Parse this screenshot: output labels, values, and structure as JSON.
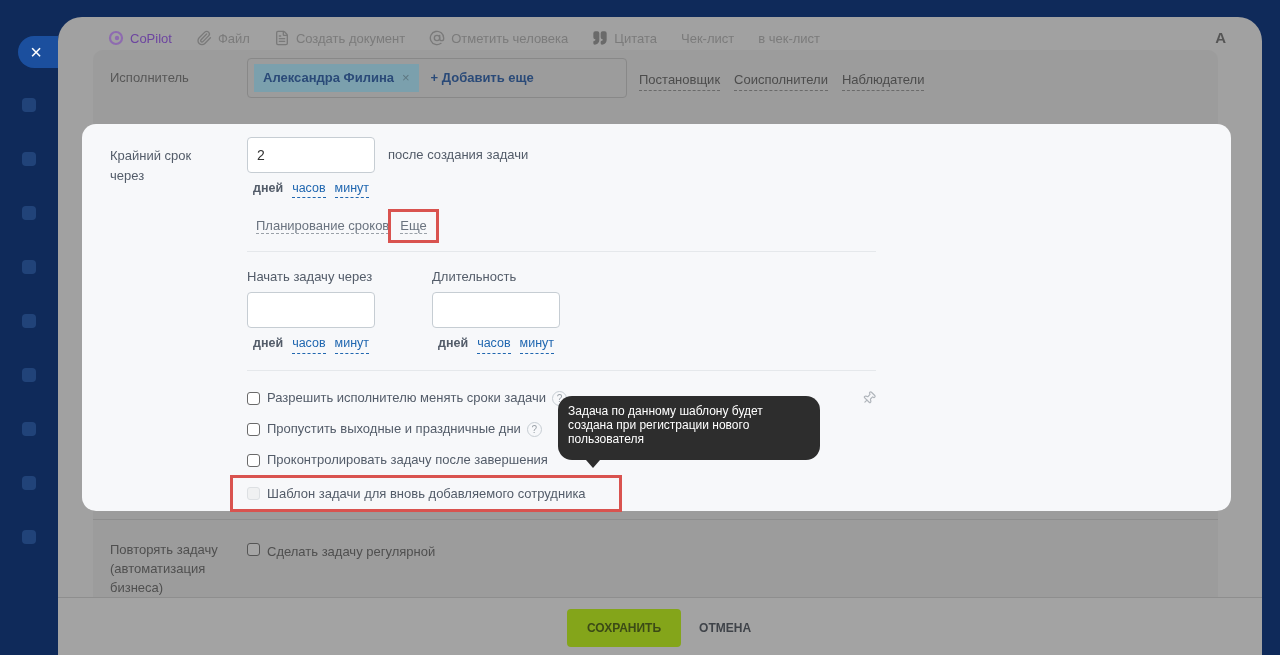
{
  "close_button": {
    "label": "×"
  },
  "toolbar": {
    "items": [
      {
        "kind": "copilot",
        "label": "CoPilot"
      },
      {
        "kind": "file",
        "label": "Файл"
      },
      {
        "kind": "document",
        "label": "Создать документ"
      },
      {
        "kind": "mention",
        "label": "Отметить человека"
      },
      {
        "kind": "quote",
        "label": "Цитата"
      },
      {
        "kind": "plain",
        "label": "Чек-лист"
      },
      {
        "kind": "plain",
        "label": "в чек-лист"
      }
    ],
    "format_button": "A"
  },
  "assignee": {
    "label": "Исполнитель",
    "person": "Александра Филина",
    "remove": "×",
    "add": "+ Добавить еще",
    "roles": [
      "Постановщик",
      "Соисполнители",
      "Наблюдатели"
    ]
  },
  "deadline": {
    "label": "Крайний срок через",
    "value": "2",
    "suffix": "после создания задачи",
    "units": [
      {
        "label": "дней",
        "selected": true
      },
      {
        "label": "часов",
        "selected": false
      },
      {
        "label": "минут",
        "selected": false
      }
    ],
    "links": [
      {
        "label": "Планирование сроков",
        "highlighted": false
      },
      {
        "label": "Еще",
        "highlighted": true
      }
    ]
  },
  "help_mark": "?",
  "planning": [
    {
      "label": "Начать задачу через",
      "units": [
        {
          "label": "дней",
          "selected": true
        },
        {
          "label": "часов",
          "selected": false
        },
        {
          "label": "минут",
          "selected": false
        }
      ]
    },
    {
      "label": "Длительность",
      "units": [
        {
          "label": "дней",
          "selected": true
        },
        {
          "label": "часов",
          "selected": false
        },
        {
          "label": "минут",
          "selected": false
        }
      ]
    }
  ],
  "options": [
    {
      "label": "Разрешить исполнителю менять сроки задачи",
      "checked": false,
      "disabled": false,
      "highlighted": false,
      "help": true
    },
    {
      "label": "Пропустить выходные и праздничные дни",
      "checked": false,
      "disabled": false,
      "highlighted": false,
      "help": true
    },
    {
      "label": "Проконтролировать задачу после завершения",
      "checked": false,
      "disabled": false,
      "highlighted": false,
      "help": false
    },
    {
      "label": "Шаблон задачи для вновь добавляемого сотрудника",
      "checked": false,
      "disabled": true,
      "highlighted": true,
      "help": false
    }
  ],
  "tooltip": "Задача по данному шаблону будет создана при регистрации нового пользователя",
  "repeat": {
    "label": "Повторять задачу (автоматизация бизнеса)",
    "option": {
      "label": "Сделать задачу регулярной",
      "checked": false
    }
  },
  "footer": {
    "buttons": [
      {
        "kind": "primary",
        "label": "СОХРАНИТЬ"
      },
      {
        "kind": "secondary",
        "label": "ОТМЕНА"
      }
    ]
  }
}
